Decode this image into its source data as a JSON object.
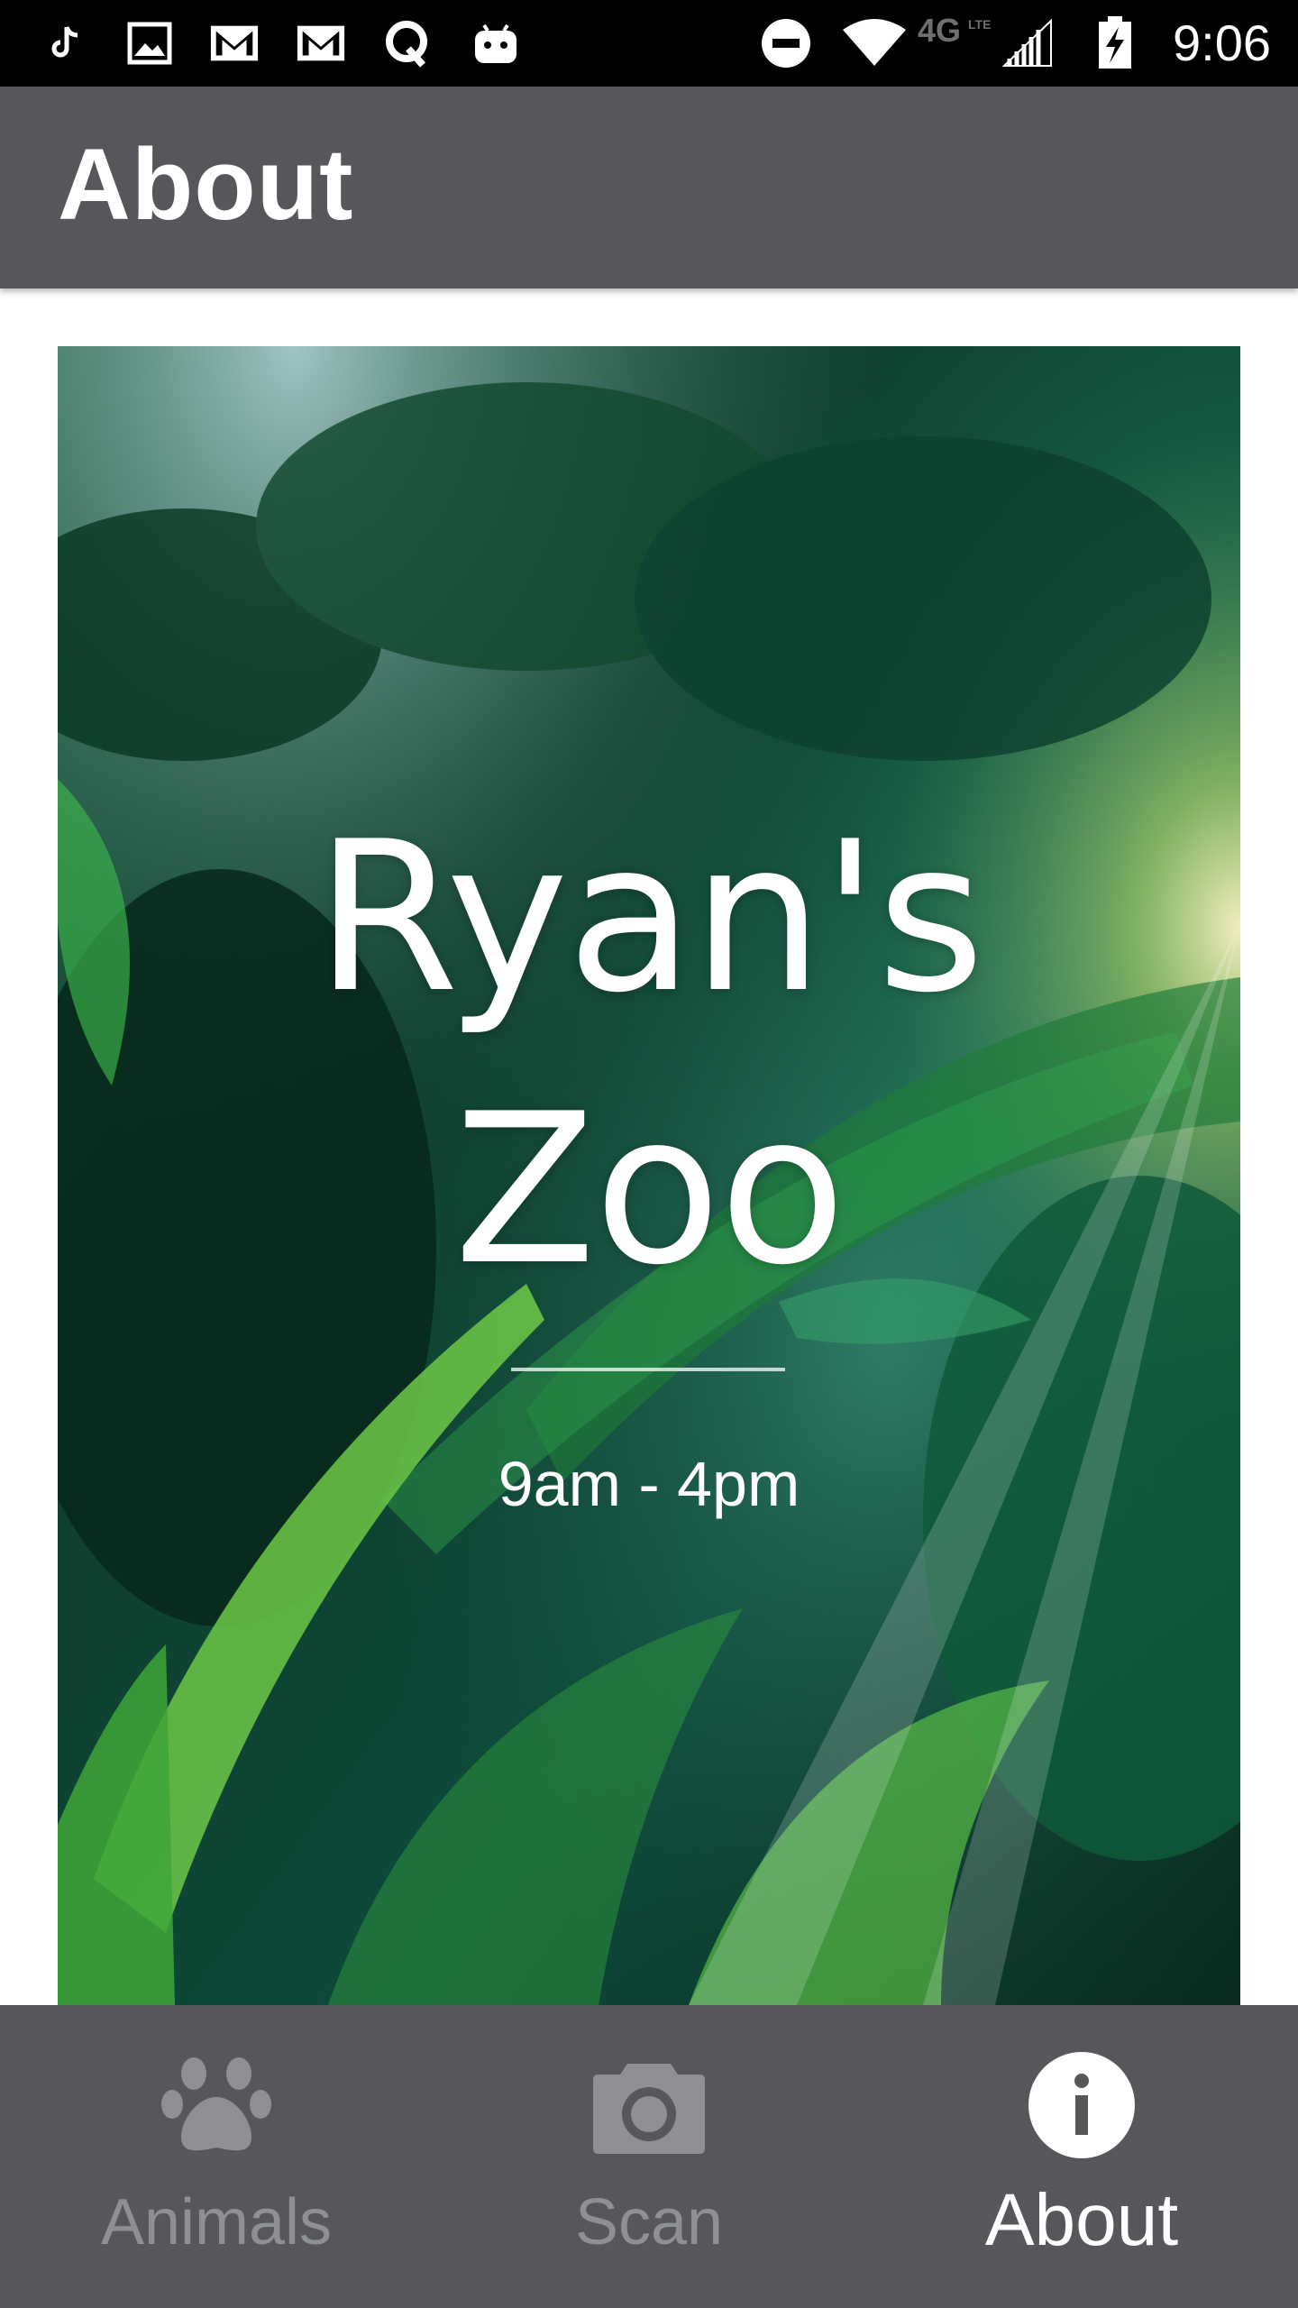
{
  "status_bar": {
    "time": "9:06",
    "network": "4G LTE",
    "icons": [
      "tiktok-icon",
      "gallery-icon",
      "gmail-icon",
      "gmail-icon",
      "quora-icon",
      "android-icon",
      "do-not-disturb-icon",
      "wifi-icon",
      "lte-icon",
      "signal-icon",
      "battery-charging-icon"
    ]
  },
  "app_bar": {
    "title": "About"
  },
  "hero": {
    "name_line1": "Ryan's",
    "name_line2": "Zoo",
    "hours": "9am - 4pm"
  },
  "bottom_nav": {
    "items": [
      {
        "label": "Animals",
        "icon": "paw-icon",
        "active": false
      },
      {
        "label": "Scan",
        "icon": "camera-icon",
        "active": false
      },
      {
        "label": "About",
        "icon": "info-icon",
        "active": true
      }
    ]
  },
  "colors": {
    "app_bar": "#55575b",
    "status_bar": "#000000",
    "nav_inactive": "#8e9094",
    "nav_active": "#ffffff"
  }
}
